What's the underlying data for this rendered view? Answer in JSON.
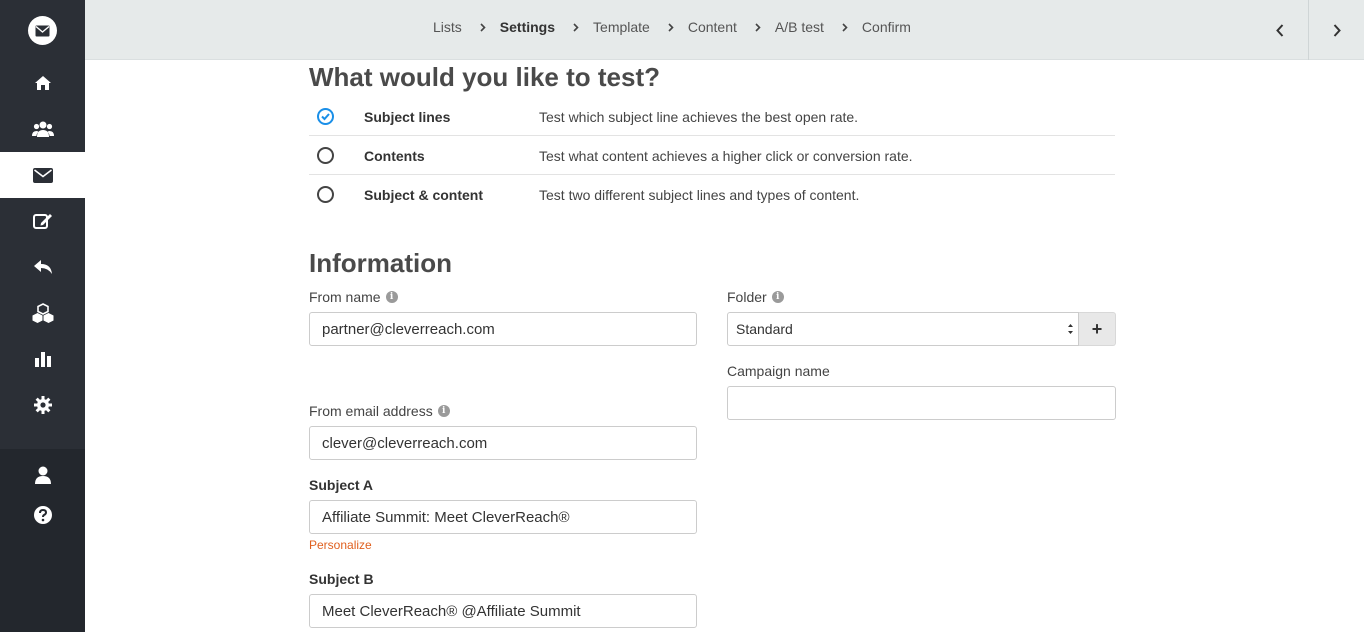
{
  "breadcrumb": {
    "items": [
      {
        "label": "Lists"
      },
      {
        "label": "Settings"
      },
      {
        "label": "Template"
      },
      {
        "label": "Content"
      },
      {
        "label": "A/B test"
      },
      {
        "label": "Confirm"
      }
    ],
    "active_index": 1
  },
  "sidebar": {
    "items": [
      {
        "icon": "home-icon"
      },
      {
        "icon": "users-icon"
      },
      {
        "icon": "envelope-icon",
        "active": true
      },
      {
        "icon": "edit-icon"
      },
      {
        "icon": "reply-icon"
      },
      {
        "icon": "cubes-icon"
      },
      {
        "icon": "bar-chart-icon"
      },
      {
        "icon": "gear-icon"
      },
      {
        "icon": "user-icon"
      },
      {
        "icon": "help-icon"
      }
    ]
  },
  "test_section": {
    "title": "What would you like to test?",
    "options": [
      {
        "name": "Subject lines",
        "description": "Test which subject line achieves the best open rate.",
        "checked": true
      },
      {
        "name": "Contents",
        "description": "Test what content achieves a higher click or conversion rate.",
        "checked": false
      },
      {
        "name": "Subject & content",
        "description": "Test two different subject lines and types of content.",
        "checked": false
      }
    ]
  },
  "information": {
    "title": "Information",
    "from_name": {
      "label": "From name",
      "value": "partner@cleverreach.com"
    },
    "folder": {
      "label": "Folder",
      "selected": "Standard",
      "add_label": "+"
    },
    "campaign_name": {
      "label": "Campaign name",
      "value": ""
    },
    "from_email": {
      "label": "From email address",
      "value": "clever@cleverreach.com"
    },
    "subject_a": {
      "label": "Subject A",
      "value": "Affiliate Summit: Meet CleverReach®",
      "personalize": "Personalize"
    },
    "subject_b": {
      "label": "Subject B",
      "value": "Meet CleverReach® @Affiliate Summit"
    }
  },
  "colors": {
    "sidebar_bg": "#2b2f36",
    "topbar_bg": "#e6eaea",
    "accent_blue": "#1a8fe8",
    "personalize_orange": "#e0601f"
  }
}
